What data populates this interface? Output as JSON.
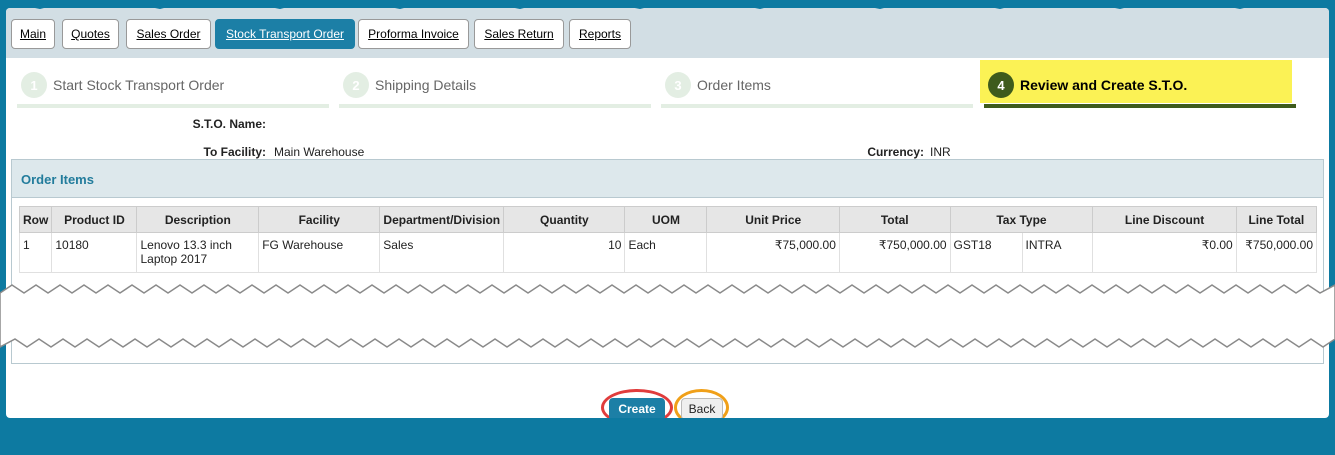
{
  "tabs": [
    {
      "label": "Main",
      "active": false
    },
    {
      "label": "Quotes",
      "active": false
    },
    {
      "label": "Sales Order",
      "active": false
    },
    {
      "label": "Stock Transport Order",
      "active": true
    },
    {
      "label": "Proforma Invoice",
      "active": false
    },
    {
      "label": "Sales Return",
      "active": false
    },
    {
      "label": "Reports",
      "active": false
    }
  ],
  "steps": [
    {
      "num": "1",
      "label": "Start Stock Transport Order",
      "active": false
    },
    {
      "num": "2",
      "label": "Shipping Details",
      "active": false
    },
    {
      "num": "3",
      "label": "Order Items",
      "active": false
    },
    {
      "num": "4",
      "label": "Review and Create S.T.O.",
      "active": true
    }
  ],
  "info": {
    "sto_name_label": "S.T.O. Name:",
    "sto_name_value": "",
    "to_facility_label": "To Facility:",
    "to_facility_value": "Main Warehouse",
    "currency_label": "Currency:",
    "currency_value": "INR"
  },
  "order_items": {
    "title": "Order Items",
    "columns": [
      "Row",
      "Product ID",
      "Description",
      "Facility",
      "Department/Division",
      "Quantity",
      "UOM",
      "Unit Price",
      "Total",
      "Tax Type",
      "Line Discount",
      "Line Total"
    ],
    "rows": [
      {
        "row": "1",
        "product_id": "10180",
        "description": "Lenovo 13.3 inch Laptop 2017",
        "facility": "FG Warehouse",
        "department": "Sales",
        "quantity": "10",
        "uom": "Each",
        "unit_price": "₹75,000.00",
        "total": "₹750,000.00",
        "tax_code": "GST18",
        "tax_kind": "INTRA",
        "line_discount": "₹0.00",
        "line_total": "₹750,000.00"
      }
    ]
  },
  "buttons": {
    "create": "Create",
    "back": "Back"
  },
  "colors": {
    "brand": "#1c7fa6",
    "background": "#0d7aa1",
    "step_active": "#3e5b1c",
    "highlight": "#fbf255",
    "create_ring": "#e03c3c",
    "back_ring": "#f0a019"
  }
}
